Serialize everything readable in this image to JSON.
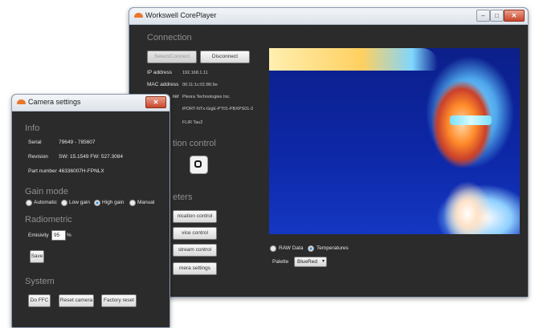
{
  "main_window": {
    "title": "Workswell CorePlayer",
    "connection": {
      "heading": "Connection",
      "select_connect_label": "Select/Connect",
      "disconnect_label": "Disconnect",
      "ip_label": "IP address",
      "ip_value": "192.168.1.11",
      "mac_label": "MAC address",
      "mac_value": "00:11:1c:01:86:9e",
      "manufacturer_label_partial": "rer",
      "manufacturer_value": "Pleora Technologies Inc.",
      "model_value": "iPORT-NTx-GigE-PT01-PBXPS01-2",
      "vendor_value": "FLIR Tau2"
    },
    "acquisition_heading_partial": "tion control",
    "parameters_heading_partial": "eters",
    "param_buttons": [
      "nication control",
      "vice control",
      "stream control",
      "mera settings"
    ],
    "display": {
      "raw_label": "RAW Data",
      "temp_label": "Temperatures",
      "selected_mode": "Temperatures",
      "palette_label": "Palette",
      "palette_value": "BlueRed"
    }
  },
  "camera_window": {
    "title": "Camera settings",
    "info": {
      "heading": "Info",
      "serial_label": "Serial",
      "serial_value": "79649 - 785607",
      "revision_label": "Revision",
      "revision_value": "SW: 15.1549  FW: 527.3084",
      "part_label": "Part number",
      "part_value": "46336007H-FPNLX"
    },
    "gain": {
      "heading": "Gain mode",
      "options": [
        "Automatic",
        "Low gain",
        "High gain",
        "Manual"
      ],
      "selected": "High gain"
    },
    "radiometric": {
      "heading": "Radiometric",
      "emissivity_label": "Emisivity",
      "emissivity_value": "95",
      "emissivity_unit": "%",
      "save_label": "Save"
    },
    "system": {
      "heading": "System",
      "buttons": [
        "Do FFC",
        "Reset camera",
        "Factory reset"
      ]
    }
  },
  "icons": {
    "app": "workswell-logo-icon",
    "stop": "stop-icon",
    "close": "close-icon"
  },
  "colors": {
    "window_bg": "#2b2b2b",
    "accent_orange": "#e8762c",
    "close_red": "#c9462c"
  }
}
